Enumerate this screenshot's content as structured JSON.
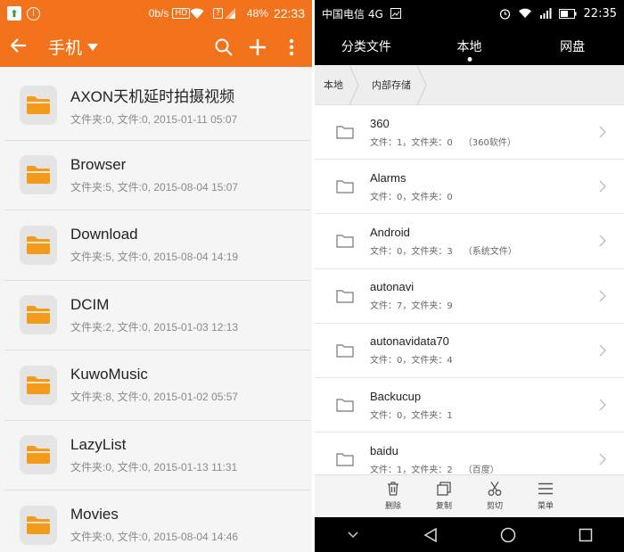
{
  "left": {
    "status": {
      "speed": "0b/s",
      "battery": "48%",
      "time": "22:33",
      "wifi_label": "wifi",
      "box1": "?"
    },
    "toolbar": {
      "title": "手机"
    },
    "items": [
      {
        "name": "AXON天机延时拍摄视频",
        "meta": "文件夹:0, 文件:0, 2015-01-11 05:07"
      },
      {
        "name": "Browser",
        "meta": "文件夹:5, 文件:0, 2015-08-04 15:07"
      },
      {
        "name": "Download",
        "meta": "文件夹:5, 文件:0, 2015-08-04 14:19"
      },
      {
        "name": "DCIM",
        "meta": "文件夹:2, 文件:0, 2015-01-03 12:13"
      },
      {
        "name": "KuwoMusic",
        "meta": "文件夹:8, 文件:0, 2015-01-02 05:57"
      },
      {
        "name": "LazyList",
        "meta": "文件夹:0, 文件:0, 2015-01-13 11:31"
      },
      {
        "name": "Movies",
        "meta": "文件夹:0, 文件:0, 2015-08-04 14:46"
      }
    ]
  },
  "right": {
    "status": {
      "carrier": "中国电信 4G",
      "time": "22:35"
    },
    "tabs": [
      "分类文件",
      "本地",
      "网盘"
    ],
    "breadcrumb": [
      "本地",
      "内部存储"
    ],
    "items": [
      {
        "name": "360",
        "meta": "文件：1，文件夹：0",
        "tag": "（360软件）"
      },
      {
        "name": "Alarms",
        "meta": "文件：0，文件夹：0",
        "tag": ""
      },
      {
        "name": "Android",
        "meta": "文件：0，文件夹：3",
        "tag": "（系统文件）"
      },
      {
        "name": "autonavi",
        "meta": "文件：7，文件夹：9",
        "tag": ""
      },
      {
        "name": "autonavidata70",
        "meta": "文件：0，文件夹：4",
        "tag": ""
      },
      {
        "name": "Backucup",
        "meta": "文件：0，文件夹：1",
        "tag": ""
      },
      {
        "name": "baidu",
        "meta": "文件：1，文件夹：2",
        "tag": "（百度）"
      }
    ],
    "toolbar": {
      "delete": "删除",
      "copy": "复制",
      "cut": "剪切",
      "menu": "菜单"
    }
  },
  "colors": {
    "accent": "#f2731b",
    "folder": "#f29a1c"
  }
}
